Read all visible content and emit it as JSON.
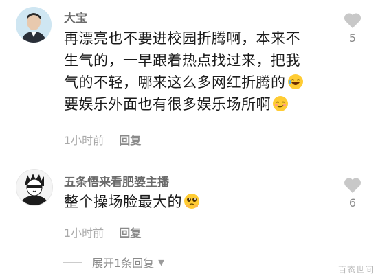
{
  "comments": [
    {
      "username": "大宝",
      "lines": [
        "再漂亮也不要进校园折腾啊，本来不",
        "生气的，一早跟着热点找过来，把我",
        "气的不轻，哪来这么多网红折腾的",
        "要娱乐外面也有很多娱乐场所啊"
      ],
      "time": "1小时前",
      "reply_label": "回复",
      "like_count": "5"
    },
    {
      "username": "五条悟来看肥婆主播",
      "lines": [
        "整个操场脸最大的"
      ],
      "time": "1小时前",
      "reply_label": "回复",
      "like_count": "6"
    }
  ],
  "expand_label": "展开1条回复",
  "watermark": "百态世间",
  "colors": {
    "username": "#6b6b6b",
    "meta": "#a9a9a9",
    "like_icon": "#c8c8c8"
  },
  "icons": [
    "heart-icon",
    "laughing-emoji-icon",
    "smirk-emoji-icon",
    "pleading-emoji-icon",
    "chevron-down-icon"
  ]
}
